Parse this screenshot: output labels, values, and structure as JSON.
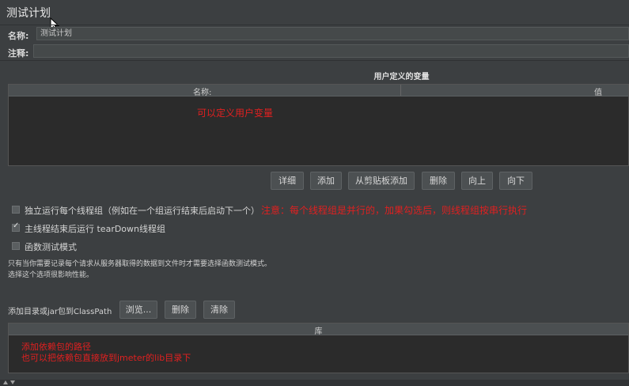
{
  "panel": {
    "title": "测试计划"
  },
  "name_row": {
    "label": "名称:",
    "value": "测试计划"
  },
  "comment_row": {
    "label": "注释:",
    "value": ""
  },
  "variables": {
    "section_title": "用户定义的变量",
    "col_name": "名称:",
    "col_value": "值",
    "annotation": "可以定义用户变量"
  },
  "var_buttons": {
    "detail": "详细",
    "add": "添加",
    "add_clipboard": "从剪贴板添加",
    "delete": "删除",
    "up": "向上",
    "down": "向下"
  },
  "options": {
    "run_serially": {
      "label": "独立运行每个线程组（例如在一个组运行结束后启动下一个）",
      "checked": false
    },
    "teardown": {
      "label": "主线程结束后运行 tearDown线程组",
      "checked": true
    },
    "functional": {
      "label": "函数测试模式",
      "checked": false
    },
    "serial_annotation": "注意：每个线程组是并行的，加果勾选后，则线程组按串行执行"
  },
  "functional_note": {
    "line1": "只有当你需要记录每个请求从服务器取得的数据到文件时才需要选择函数测试模式。",
    "line2": "选择这个选项很影响性能。"
  },
  "classpath": {
    "label": "添加目录或jar包到ClassPath",
    "browse": "浏览...",
    "delete": "删除",
    "clear": "清除",
    "col_lib": "库",
    "annotation1": "添加依赖包的路径",
    "annotation2": "也可以把依赖包直接放到jmeter的lib目录下"
  },
  "colors": {
    "background": "#3c3f41",
    "annotation": "#e02020"
  }
}
